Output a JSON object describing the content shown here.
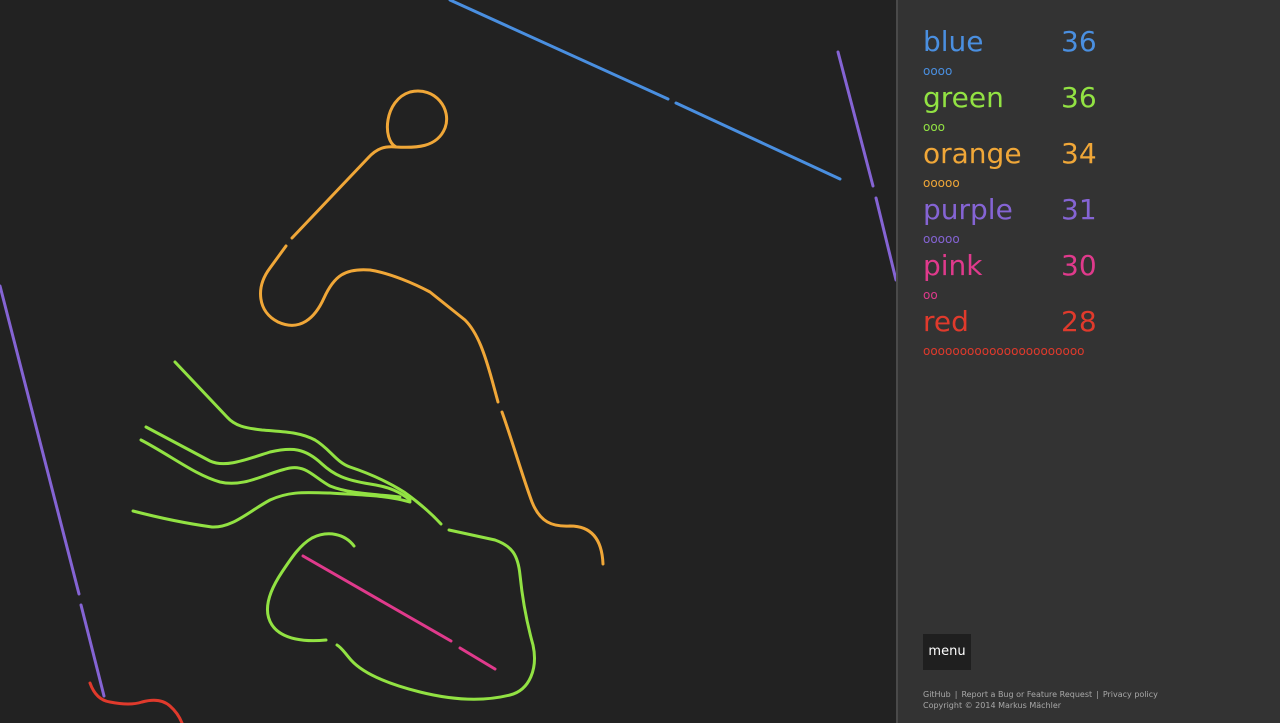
{
  "players": [
    {
      "name": "blue",
      "score": "36",
      "lives": "oooo",
      "color": "#4a8fe0"
    },
    {
      "name": "green",
      "score": "36",
      "lives": "ooo",
      "color": "#92e243"
    },
    {
      "name": "orange",
      "score": "34",
      "lives": "ooooo",
      "color": "#f0a738"
    },
    {
      "name": "purple",
      "score": "31",
      "lives": "ooooo",
      "color": "#8564d4"
    },
    {
      "name": "pink",
      "score": "30",
      "lives": "oo",
      "color": "#e03a8c"
    },
    {
      "name": "red",
      "score": "28",
      "lives": "oooooooooooooooooooooo",
      "color": "#e03a2c"
    }
  ],
  "menu": {
    "label": "menu"
  },
  "footer": {
    "links": [
      "GitHub",
      "Report a Bug or Feature Request",
      "Privacy policy"
    ],
    "separator": "|",
    "copyright": "Copyright © 2014 Markus Mächler"
  },
  "colors": {
    "canvas_background": "#222222",
    "sidebar_background": "#333333"
  }
}
